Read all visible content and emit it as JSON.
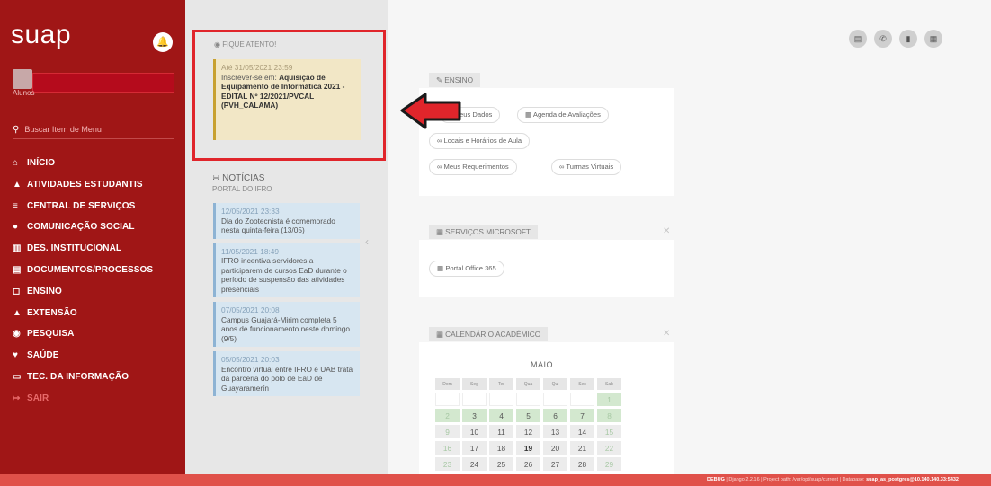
{
  "sidebar": {
    "logo": "suap",
    "user_sublabel": "Alunos",
    "search_placeholder": "Buscar Item de Menu",
    "menu": [
      {
        "label": "INÍCIO",
        "icon": "home-icon",
        "glyph": "⌂"
      },
      {
        "label": "ATIVIDADES ESTUDANTIS",
        "icon": "graduation-cap-icon",
        "glyph": "▲"
      },
      {
        "label": "CENTRAL DE SERVIÇOS",
        "icon": "list-icon",
        "glyph": "≡"
      },
      {
        "label": "COMUNICAÇÃO SOCIAL",
        "icon": "speech-bubble-icon",
        "glyph": "●"
      },
      {
        "label": "DES. INSTITUCIONAL",
        "icon": "chart-icon",
        "glyph": "▥"
      },
      {
        "label": "DOCUMENTOS/PROCESSOS",
        "icon": "file-icon",
        "glyph": "▤"
      },
      {
        "label": "ENSINO",
        "icon": "book-icon",
        "glyph": "◻"
      },
      {
        "label": "EXTENSÃO",
        "icon": "bell-icon",
        "glyph": "▲"
      },
      {
        "label": "PESQUISA",
        "icon": "microscope-icon",
        "glyph": "◉"
      },
      {
        "label": "SAÚDE",
        "icon": "heart-icon",
        "glyph": "♥"
      },
      {
        "label": "TEC. DA INFORMAÇÃO",
        "icon": "monitor-icon",
        "glyph": "▭"
      },
      {
        "label": "SAIR",
        "icon": "logout-icon",
        "glyph": "↦"
      }
    ]
  },
  "alert": {
    "title": "FIQUE ATENTO!",
    "date": "Até 31/05/2021 23:59",
    "prefix": "Inscrever-se em:",
    "text": "Aquisição de Equipamento de Informática 2021 - EDITAL Nº 12/2021/PVCAL (PVH_CALAMA)"
  },
  "news": {
    "title": "NOTÍCIAS",
    "subtitle": "PORTAL DO IFRO",
    "items": [
      {
        "date": "12/05/2021 23:33",
        "text": "Dia do Zootecnista é comemorado nesta quinta-feira (13/05)"
      },
      {
        "date": "11/05/2021 18:49",
        "text": "IFRO incentiva servidores a participarem de cursos EaD durante o período de suspensão das atividades presenciais"
      },
      {
        "date": "07/05/2021 20:08",
        "text": "Campus Guajará-Mirim completa 5 anos de funcionamento neste domingo (9/5)"
      },
      {
        "date": "05/05/2021 20:03",
        "text": "Encontro virtual entre IFRO e UAB trata da parceria do polo de EaD de Guayaramerín"
      }
    ]
  },
  "ensino": {
    "tab": "ENSINO",
    "links": [
      "Meus Dados",
      "Agenda de Avaliações",
      "Locais e Horários de Aula",
      "Meus Requerimentos",
      "Turmas Virtuais"
    ]
  },
  "microsoft": {
    "tab": "SERVIÇOS MICROSOFT",
    "links": [
      "Portal Office 365"
    ]
  },
  "calendar": {
    "tab": "CALENDÁRIO ACADÊMICO",
    "month": "MAIO",
    "weekdays": [
      "Dom",
      "Seg",
      "Ter",
      "Qua",
      "Qui",
      "Sex",
      "Sab"
    ],
    "today": 19
  },
  "footer": {
    "debug": "DEBUG",
    "django": "Django 2.2.16",
    "project": "Project path: /var/opt/suap/current",
    "database_label": "Database:",
    "database": "suap_as_postgres@10.140.140.33:5432"
  },
  "colors": {
    "sidebar": "#a01616",
    "alert_border": "#e0252b",
    "footer": "#e0514a"
  }
}
